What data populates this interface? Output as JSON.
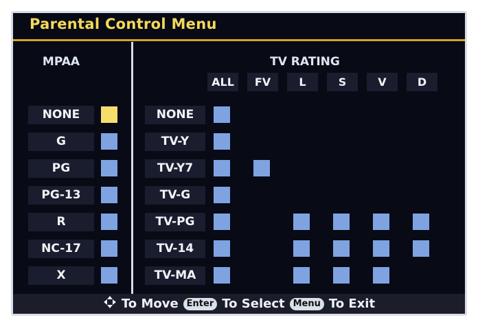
{
  "title": "Parental Control Menu",
  "mpaa": {
    "heading": "MPAA",
    "items": [
      {
        "label": "NONE",
        "selected": true
      },
      {
        "label": "G",
        "selected": false
      },
      {
        "label": "PG",
        "selected": false
      },
      {
        "label": "PG-13",
        "selected": false
      },
      {
        "label": "R",
        "selected": false
      },
      {
        "label": "NC-17",
        "selected": false
      },
      {
        "label": "X",
        "selected": false
      }
    ]
  },
  "tv": {
    "heading": "TV RATING",
    "columns": [
      "ALL",
      "FV",
      "L",
      "S",
      "V",
      "D"
    ],
    "rows": [
      {
        "label": "NONE",
        "boxes": [
          true,
          false,
          false,
          false,
          false,
          false
        ]
      },
      {
        "label": "TV-Y",
        "boxes": [
          true,
          false,
          false,
          false,
          false,
          false
        ]
      },
      {
        "label": "TV-Y7",
        "boxes": [
          true,
          true,
          false,
          false,
          false,
          false
        ]
      },
      {
        "label": "TV-G",
        "boxes": [
          true,
          false,
          false,
          false,
          false,
          false
        ]
      },
      {
        "label": "TV-PG",
        "boxes": [
          true,
          false,
          true,
          true,
          true,
          true
        ]
      },
      {
        "label": "TV-14",
        "boxes": [
          true,
          false,
          true,
          true,
          true,
          true
        ]
      },
      {
        "label": "TV-MA",
        "boxes": [
          true,
          false,
          true,
          true,
          true,
          false
        ]
      }
    ]
  },
  "footer": {
    "move_icon": "four-way-arrow-icon",
    "move": "To Move",
    "enter_key": "Enter",
    "select": "To Select",
    "menu_key": "Menu",
    "exit": "To Exit"
  },
  "colors": {
    "checkbox": "#7fa3e0",
    "checkbox_selected": "#f5de6c",
    "title": "#f2d95a"
  }
}
